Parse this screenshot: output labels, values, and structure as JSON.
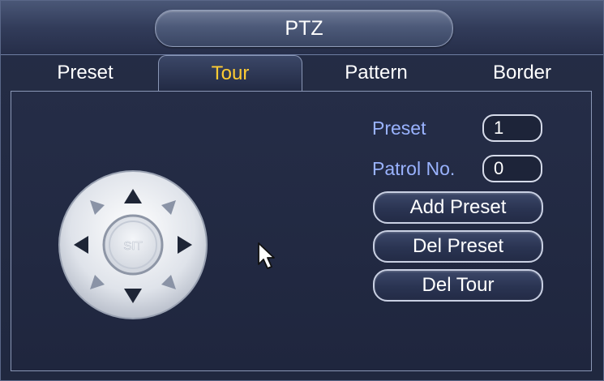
{
  "window": {
    "title": "PTZ"
  },
  "tabs": [
    {
      "label": "Preset",
      "active": false
    },
    {
      "label": "Tour",
      "active": true
    },
    {
      "label": "Pattern",
      "active": false
    },
    {
      "label": "Border",
      "active": false
    }
  ],
  "tour": {
    "preset_label": "Preset",
    "preset_value": "1",
    "patrol_label": "Patrol No.",
    "patrol_value": "0",
    "add_preset_label": "Add Preset",
    "del_preset_label": "Del Preset",
    "del_tour_label": "Del Tour"
  },
  "dpad": {
    "center_label": "SIT"
  },
  "colors": {
    "accent_active_tab": "#ffcc33",
    "label_blue": "#9ab3ff",
    "background": "#20283f"
  },
  "icons": {
    "direction_pad": "direction-pad-icon",
    "cursor": "mouse-pointer-icon"
  }
}
